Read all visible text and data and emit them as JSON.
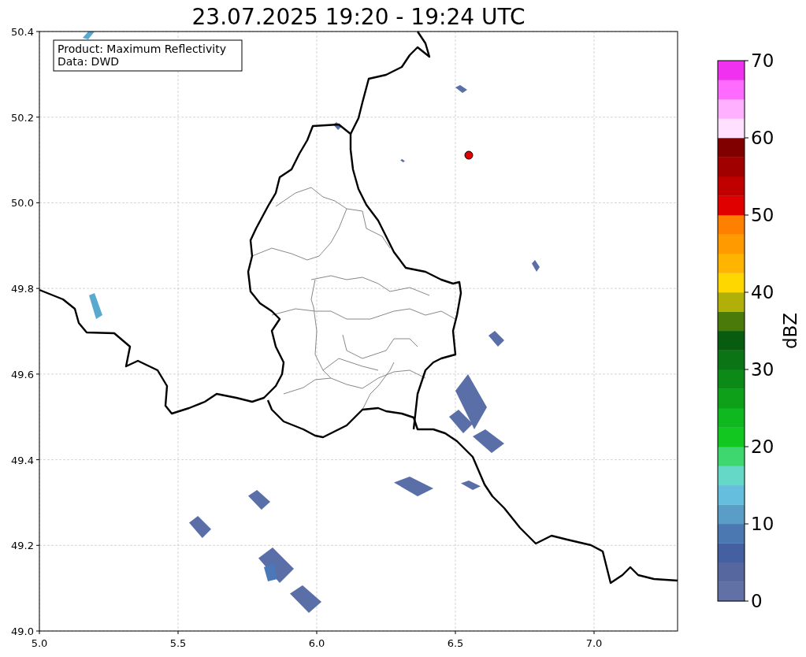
{
  "title": "23.07.2025 19:20 - 19:24 UTC",
  "info_box": {
    "lines": [
      "Product: Maximum Reflectivity",
      "Data: DWD"
    ]
  },
  "map": {
    "x_tick_labels": [
      "5.0",
      "5.5",
      "6.0",
      "6.5",
      "7.0"
    ],
    "y_tick_labels": [
      "50.4",
      "50.2",
      "50.0",
      "49.8",
      "49.6",
      "49.4",
      "49.2",
      "49.0"
    ]
  },
  "colorbar": {
    "label": "dBZ",
    "tick_labels": [
      "70",
      "60",
      "50",
      "40",
      "30",
      "20",
      "10",
      "0"
    ],
    "segments": [
      {
        "color": "#6170a5"
      },
      {
        "color": "#56679f"
      },
      {
        "color": "#4560a0"
      },
      {
        "color": "#4b78b0"
      },
      {
        "color": "#5a9ec8"
      },
      {
        "color": "#65bedd"
      },
      {
        "color": "#66d8c8"
      },
      {
        "color": "#3ed66e"
      },
      {
        "color": "#12c820"
      },
      {
        "color": "#10b820"
      },
      {
        "color": "#0fa01a"
      },
      {
        "color": "#0c8a18"
      },
      {
        "color": "#0b7415"
      },
      {
        "color": "#085c10"
      },
      {
        "color": "#4a7a0a"
      },
      {
        "color": "#b0b008"
      },
      {
        "color": "#ffd700"
      },
      {
        "color": "#ffb400"
      },
      {
        "color": "#ff9b00"
      },
      {
        "color": "#ff7f00"
      },
      {
        "color": "#e00000"
      },
      {
        "color": "#c00000"
      },
      {
        "color": "#a00000"
      },
      {
        "color": "#800000"
      },
      {
        "color": "#ffe0ff"
      },
      {
        "color": "#ffb0ff"
      },
      {
        "color": "#ff6aff"
      },
      {
        "color": "#f032f0"
      }
    ]
  }
}
